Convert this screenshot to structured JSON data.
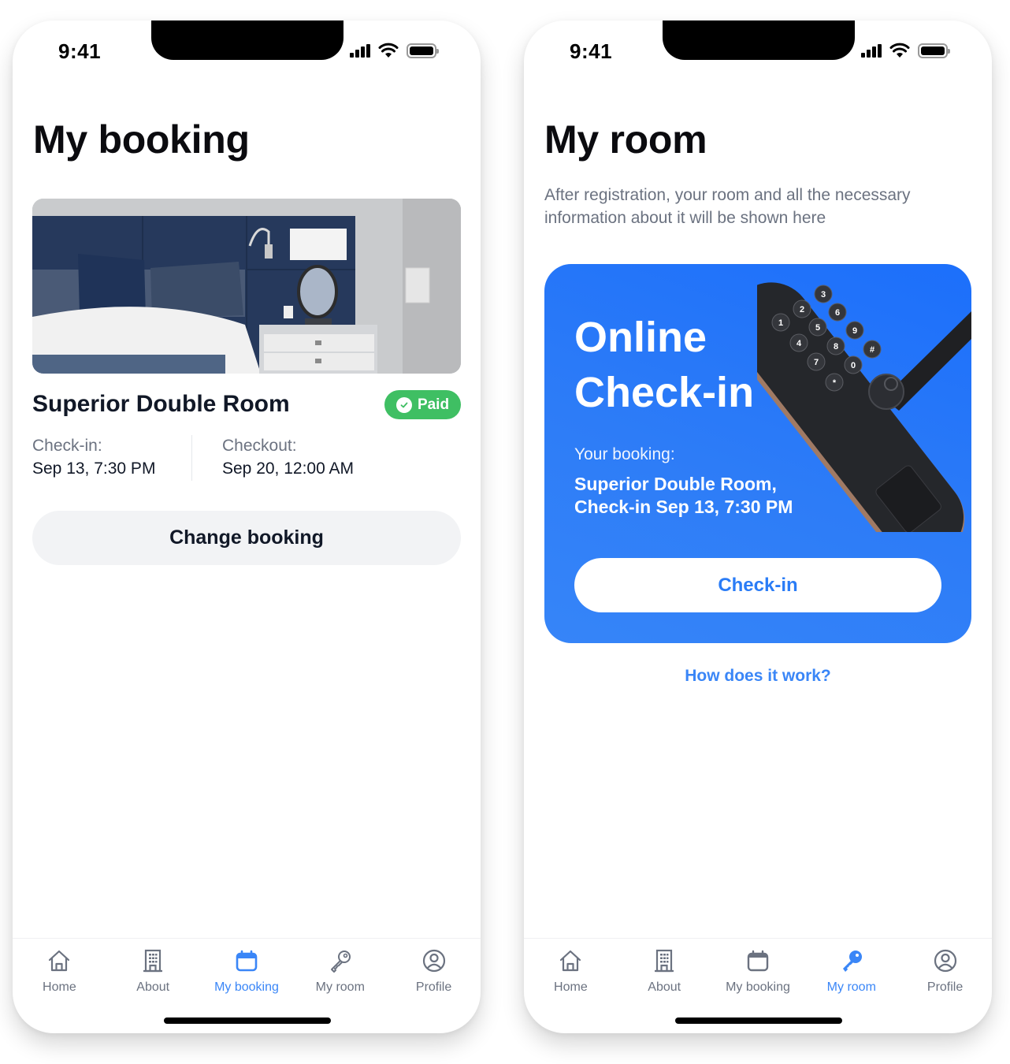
{
  "colors": {
    "accent": "#3a86f7",
    "paid_green": "#3fbf63",
    "card_blue": "#2a7cf6",
    "muted_text": "#6b7280",
    "button_bg": "#f2f3f5"
  },
  "status_bar": {
    "time": "9:41"
  },
  "booking_screen": {
    "title": "My booking",
    "room_photo": "hotel-room-photo",
    "room_name": "Superior Double Room",
    "status_badge": {
      "label": "Paid",
      "icon": "check-circle-icon"
    },
    "check_in": {
      "label": "Check-in:",
      "value": "Sep 13, 7:30 PM"
    },
    "checkout": {
      "label": "Checkout:",
      "value": "Sep 20, 12:00 AM"
    },
    "change_button": "Change booking"
  },
  "room_screen": {
    "title": "My room",
    "subtitle": "After registration, your room and all the necessary information about it will be shown here",
    "card": {
      "title_line1": "Online",
      "title_line2": "Check-in",
      "booking_label": "Your booking:",
      "booking_line1": "Superior Double Room,",
      "booking_line2": "Check-in Sep 13, 7:30 PM",
      "button": "Check-in",
      "image": "smart-door-lock-keypad",
      "keypad_keys": [
        "1",
        "2",
        "3",
        "4",
        "5",
        "6",
        "7",
        "8",
        "9",
        "*",
        "0",
        "#"
      ]
    },
    "help_link": "How does it work?"
  },
  "tabbar": {
    "items": [
      {
        "label": "Home",
        "icon": "home-icon"
      },
      {
        "label": "About",
        "icon": "building-icon"
      },
      {
        "label": "My booking",
        "icon": "calendar-icon"
      },
      {
        "label": "My room",
        "icon": "key-icon"
      },
      {
        "label": "Profile",
        "icon": "profile-icon"
      }
    ],
    "active_left": "My booking",
    "active_right": "My room"
  }
}
